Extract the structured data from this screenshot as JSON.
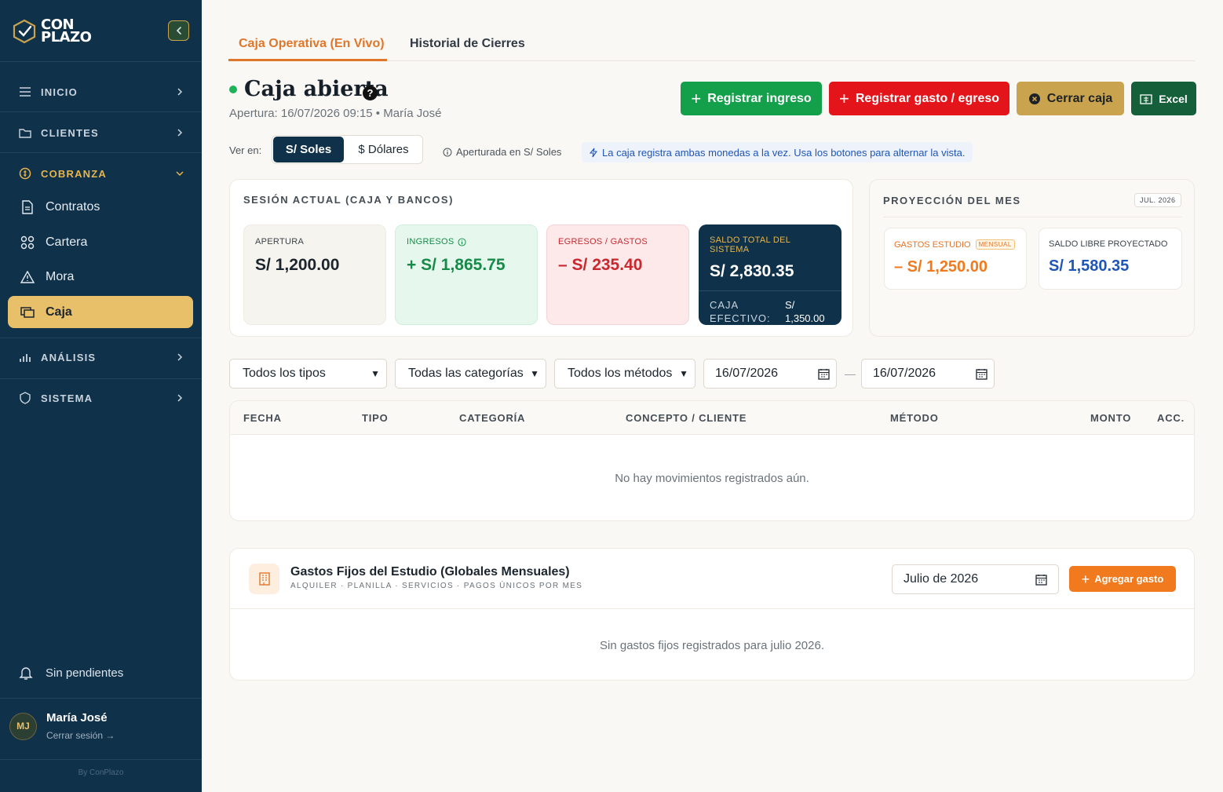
{
  "brand": {
    "line1": "CON",
    "line2": "PLAZO"
  },
  "sidebar": {
    "groups": {
      "inicio": "INICIO",
      "clientes": "CLIENTES",
      "cobranza": "COBRANZA",
      "analisis": "ANÁLISIS",
      "sistema": "SISTEMA"
    },
    "items": {
      "contratos": "Contratos",
      "cartera": "Cartera",
      "mora": "Mora",
      "caja": "Caja"
    },
    "pending": "Sin pendientes",
    "user": {
      "initials": "MJ",
      "name": "María José",
      "logout": "Cerrar sesión →"
    },
    "byline": "By ConPlazo"
  },
  "tabs": {
    "live": "Caja Operativa (En Vivo)",
    "history": "Historial de Cierres"
  },
  "header": {
    "title": "Caja abierta",
    "subtitle": "Apertura: 16/07/2026 09:15 • María José"
  },
  "actions": {
    "income": "Registrar ingreso",
    "expense": "Registrar gasto / egreso",
    "close": "Cerrar caja",
    "excel": "Excel"
  },
  "currency": {
    "label": "Ver en:",
    "soles": "S/ Soles",
    "dollars": "$ Dólares",
    "opened_in": "Aperturada en S/ Soles",
    "note": "La caja registra ambas monedas a la vez. Usa los botones para alternar la vista."
  },
  "session": {
    "title": "SESIÓN ACTUAL (CAJA Y BANCOS)",
    "apertura_label": "APERTURA",
    "apertura_value": "S/ 1,200.00",
    "ingresos_label": "INGRESOS",
    "ingresos_value": "+ S/ 1,865.75",
    "egresos_label": "EGRESOS / GASTOS",
    "egresos_value": "– S/ 235.40",
    "saldo_label": "SALDO TOTAL DEL SISTEMA",
    "saldo_value": "S/ 2,830.35",
    "cash_label_1": "CAJA",
    "cash_label_2": "EFECTIVO:",
    "cash_currency": "S/",
    "cash_value": "1,350.00"
  },
  "projection": {
    "title": "PROYECCIÓN DEL MES",
    "month": "JUL. 2026",
    "gastos_label": "GASTOS ESTUDIO",
    "gastos_badge": "MENSUAL",
    "gastos_value": "– S/ 1,250.00",
    "libre_label": "SALDO LIBRE PROYECTADO",
    "libre_value": "S/ 1,580.35"
  },
  "filters": {
    "tipos": "Todos los tipos",
    "categorias": "Todas las categorías",
    "metodos": "Todos los métodos",
    "date_from": "16/07/2026",
    "date_to": "16/07/2026",
    "dash": "—"
  },
  "table": {
    "columns": [
      "FECHA",
      "TIPO",
      "CATEGORÍA",
      "CONCEPTO / CLIENTE",
      "MÉTODO",
      "MONTO",
      "ACC."
    ],
    "empty": "No hay movimientos registrados aún."
  },
  "fixed": {
    "title": "Gastos Fijos del Estudio (Globales Mensuales)",
    "subtitle": "ALQUILER · PLANILLA · SERVICIOS · PAGOS ÚNICOS POR MES",
    "month": "Julio de 2026",
    "add": "Agregar gasto",
    "empty": "Sin gastos fijos registrados para julio 2026."
  },
  "colors": {
    "sidebar": "#10314a",
    "accent_gold": "#e8c06a",
    "accent_orange": "#e0762a",
    "green": "#14a04a",
    "red": "#e4141b"
  }
}
